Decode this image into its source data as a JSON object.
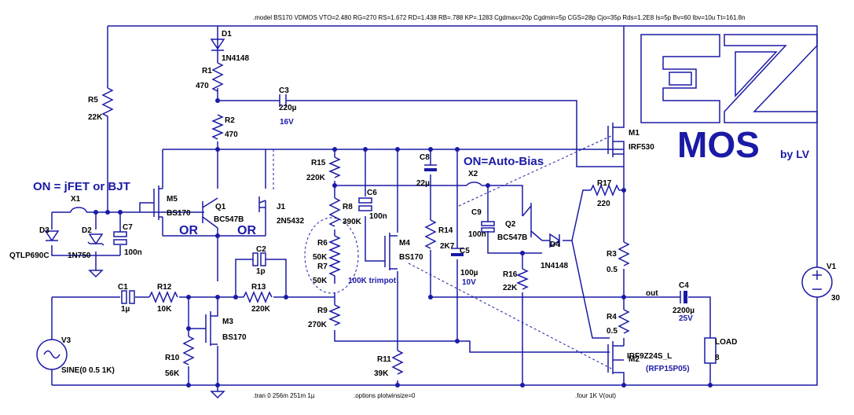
{
  "model_directive": ".model BS170 VDMOS VTO=2.480 RG=270 RS=1.672 RD=1.438 RB=.788 KP=.1283 Cgdmax=20p Cgdmin=5p CGS=28p Cjo=35p Rds=1.2E8 Is=5p Bv=60 Ibv=10u Tt=161.8n",
  "tran_directive": ".tran 0 256m 251m 1µ",
  "options_directive": ".options plotwinsize=0",
  "four_directive": ".four 1K V(out)",
  "logo": {
    "text": "EZ",
    "word": "MOS",
    "author": "by LV",
    "color": "#1a1aa6"
  },
  "notes": {
    "jfet_bjt": "ON = jFET or BJT",
    "auto_bias": "ON=Auto-Bias",
    "or1": "OR",
    "or2": "OR",
    "trimpot": "100K trimpot",
    "out_net": "out"
  },
  "components": [
    {
      "ref": "D1",
      "value": "1N4148"
    },
    {
      "ref": "R1",
      "value": "470"
    },
    {
      "ref": "R2",
      "value": "470"
    },
    {
      "ref": "C3",
      "value": "220µ",
      "rating": "16V"
    },
    {
      "ref": "R5",
      "value": "22K"
    },
    {
      "ref": "R15",
      "value": "220K"
    },
    {
      "ref": "C8",
      "value": "22µ"
    },
    {
      "ref": "C6",
      "value": "100n"
    },
    {
      "ref": "R8",
      "value": "390K"
    },
    {
      "ref": "R14",
      "value": "2K7"
    },
    {
      "ref": "C5",
      "value": "100µ",
      "rating": "10V"
    },
    {
      "ref": "X2",
      "value": ""
    },
    {
      "ref": "C9",
      "value": "100n"
    },
    {
      "ref": "Q2",
      "value": "BC547B"
    },
    {
      "ref": "D4",
      "value": "1N4148"
    },
    {
      "ref": "R16",
      "value": "22K"
    },
    {
      "ref": "R17",
      "value": "220"
    },
    {
      "ref": "M1",
      "value": "IRF530"
    },
    {
      "ref": "R3",
      "value": "0.5"
    },
    {
      "ref": "R4",
      "value": "0.5"
    },
    {
      "ref": "M2",
      "value": "IRF9Z24S_L",
      "alt": "(RFP15P05)"
    },
    {
      "ref": "C4",
      "value": "2200µ",
      "rating": "25V"
    },
    {
      "ref": "LOAD",
      "value": "8"
    },
    {
      "ref": "V1",
      "value": "30"
    },
    {
      "ref": "X1",
      "value": ""
    },
    {
      "ref": "D3",
      "value": "QTLP690C"
    },
    {
      "ref": "D2",
      "value": "1N750"
    },
    {
      "ref": "C7",
      "value": "100n"
    },
    {
      "ref": "M5",
      "value": "BS170"
    },
    {
      "ref": "Q1",
      "value": "BC547B"
    },
    {
      "ref": "J1",
      "value": "2N5432"
    },
    {
      "ref": "R6",
      "value": "50K"
    },
    {
      "ref": "R7",
      "value": "50K"
    },
    {
      "ref": "M4",
      "value": "BS170"
    },
    {
      "ref": "R9",
      "value": "270K"
    },
    {
      "ref": "C2",
      "value": "1p"
    },
    {
      "ref": "R13",
      "value": "220K"
    },
    {
      "ref": "C1",
      "value": "1µ"
    },
    {
      "ref": "R12",
      "value": "10K"
    },
    {
      "ref": "M3",
      "value": "BS170"
    },
    {
      "ref": "R10",
      "value": "56K"
    },
    {
      "ref": "R11",
      "value": "39K"
    },
    {
      "ref": "V3",
      "value": "SINE(0 0.5 1K)"
    }
  ]
}
